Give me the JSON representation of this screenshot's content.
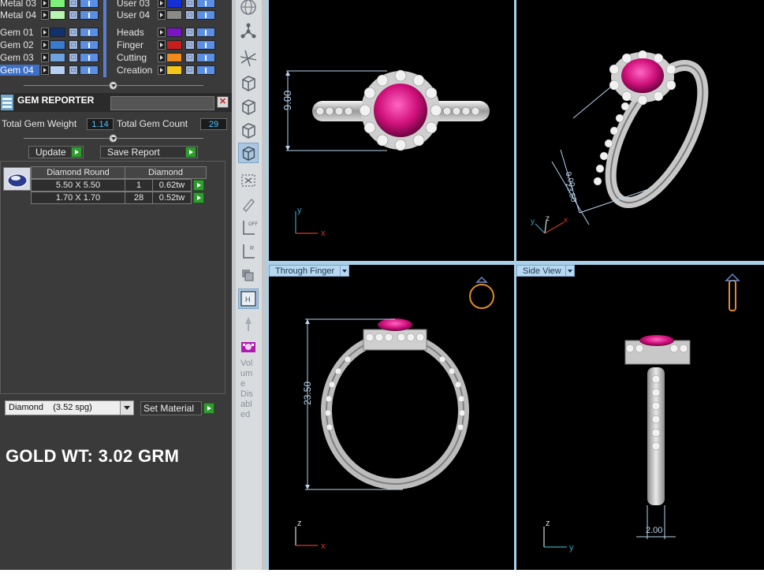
{
  "layers": {
    "left_column": [
      {
        "name": "Metal 03",
        "color": "#7df07a",
        "selected": false
      },
      {
        "name": "Metal 04",
        "color": "#b8f5b0",
        "selected": false
      },
      {
        "name": "Gem 01",
        "color": "#10306e",
        "selected": false
      },
      {
        "name": "Gem 02",
        "color": "#3a7ad0",
        "selected": false
      },
      {
        "name": "Gem 03",
        "color": "#6fa3e0",
        "selected": false
      },
      {
        "name": "Gem 04",
        "color": "#b6d0f2",
        "selected": true
      }
    ],
    "right_column": [
      {
        "name": "User 03",
        "color": "#1430d8"
      },
      {
        "name": "User 04",
        "color": "#8a8a8a"
      },
      {
        "name": "Heads",
        "color": "#7a16c4"
      },
      {
        "name": "Finger",
        "color": "#c81e1e"
      },
      {
        "name": "Cutting",
        "color": "#f08a1a"
      },
      {
        "name": "Creation",
        "color": "#f5c61a"
      }
    ]
  },
  "gem_reporter": {
    "title": "GEM REPORTER",
    "close_icon": "close-icon",
    "total_weight_label": "Total Gem Weight",
    "total_weight_value": "1.14",
    "total_count_label": "Total Gem Count",
    "total_count_value": "29",
    "update_label": "Update",
    "save_report_label": "Save Report",
    "table": {
      "headers": [
        "Diamond Round",
        "Diamond"
      ],
      "rows": [
        {
          "size": "5.50 X 5.50",
          "count": "1",
          "weight": "0.62tw"
        },
        {
          "size": "1.70 X 1.70",
          "count": "28",
          "weight": "0.52tw"
        }
      ]
    },
    "material_select": "Diamond    (3.52 spg)",
    "set_material_label": "Set Material"
  },
  "gold_weight": "GOLD WT: 3.02 GRM",
  "toolbar": {
    "icons": [
      "globe-icon",
      "node-graph-icon",
      "axis-cursor-icon",
      "cube-front-icon",
      "cube-iso-icon",
      "cube-side-icon",
      "cube-selected-icon",
      "grid-snap-icon",
      "measure-icon",
      "axis-off-icon",
      "axis-r-icon",
      "layers-icon",
      "h-button-icon",
      "pointer-icon",
      "volume-icon"
    ],
    "axis_off_text": "OFF",
    "axis_r_text": "R",
    "h_text": "H",
    "volume_disabled_text": "Vol um e Dis abl ed"
  },
  "viewports": {
    "top_left": {
      "dimension": "9.00",
      "axis_vertical": "y",
      "axis_horizontal": "x"
    },
    "top_right": {
      "dimension_a": "23.50",
      "dimension_b": "9.00",
      "axis_labels": [
        "y",
        "z",
        "x"
      ]
    },
    "bottom_left": {
      "label": "Through Finger",
      "dimension": "23.50",
      "axis_vertical": "z",
      "axis_horizontal": "x",
      "preview_icon": "ring-front-icon"
    },
    "bottom_right": {
      "label": "Side View",
      "dimension": "2.00",
      "axis_vertical": "z",
      "axis_horizontal": "y",
      "preview_icon": "ring-side-icon"
    }
  },
  "colors": {
    "panel_bg": "#3a3a3a",
    "viewport_bg": "#000000",
    "viewport_border": "#a8d0e8",
    "value_text": "#4fc0ff",
    "gem_color": "#d0107a",
    "metal_color": "#c8c8c8",
    "dimension_line": "#b8d4ee",
    "axis_red": "#d23a2a",
    "axis_teal": "#3aa0b8"
  }
}
